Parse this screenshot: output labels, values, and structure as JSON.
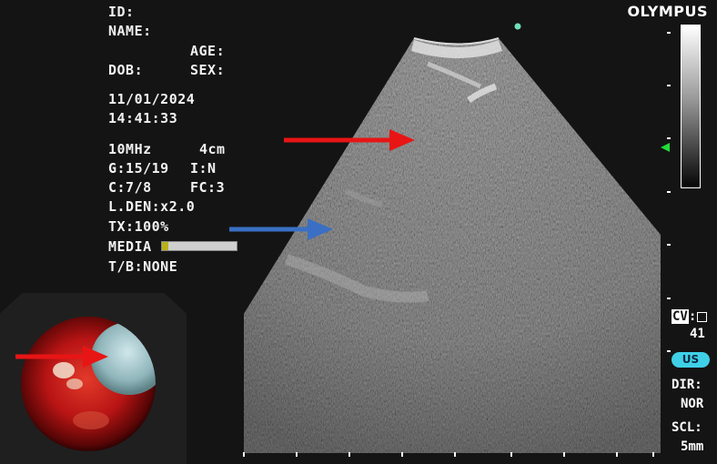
{
  "brand": "OLYMPUS",
  "patient": {
    "id_label": "ID:",
    "name_label": "NAME:",
    "age_label": "AGE:",
    "dob_label": "DOB:",
    "sex_label": "SEX:"
  },
  "exam": {
    "date": "11/01/2024",
    "time": "14:41:33"
  },
  "settings": {
    "frequency": "10MHz",
    "depth": "4cm",
    "gain": "G:15/19",
    "image_setting": "I:N",
    "contrast": "C:7/8",
    "fc": "FC:3",
    "line_density": "L.DEN:x2.0",
    "tx_power": "TX:100%",
    "media_label": "MEDIA",
    "media_fill_fraction": 0.08,
    "tb": "T/B:NONE"
  },
  "right_panel": {
    "cv_label": "CV",
    "cv_colon": ":",
    "cv_value": "41",
    "mode_badge": "US",
    "dir_label": "DIR:",
    "dir_value": "NOR",
    "scl_label": "SCL:",
    "scl_value": "5mm"
  },
  "colors": {
    "annotation_red": "#e81515",
    "annotation_blue": "#3a6fc4",
    "focus_marker": "#1fdc3a",
    "mode_badge": "#3fd0e8",
    "media_level": "#b7b21a",
    "indicator_dot": "#6fe0b8"
  },
  "icons": {
    "focus_marker": "green-triangle-left",
    "indicator": "teal-dot",
    "arrows": "right-pointing-arrow"
  }
}
